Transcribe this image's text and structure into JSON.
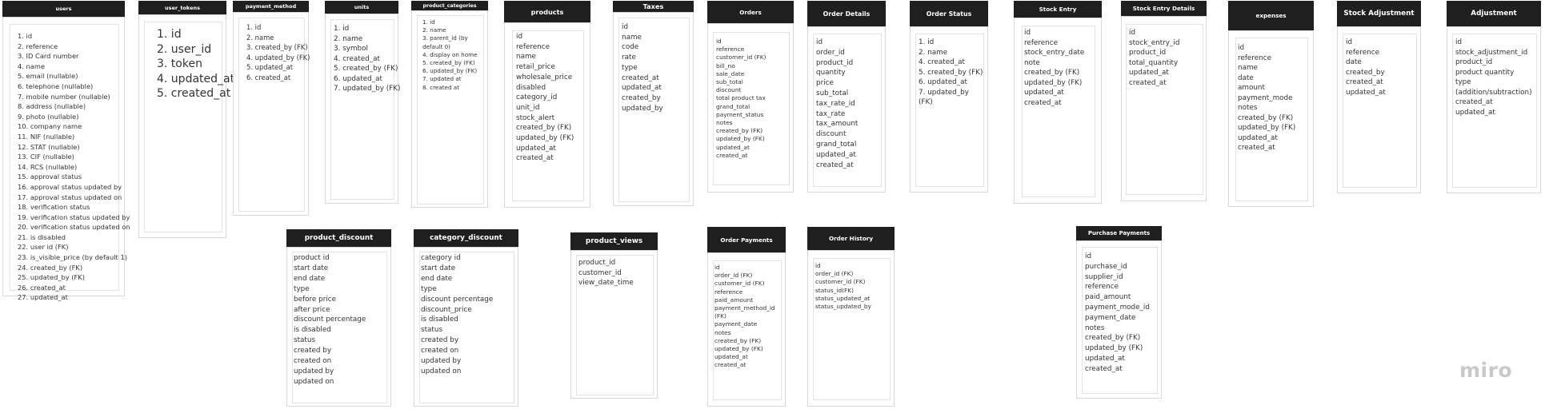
{
  "entities": [
    {
      "key": "users",
      "name": "users",
      "fields": [
        "1. id",
        "2. reference",
        "3. ID Card number",
        "4. name",
        "5. email (nullable)",
        "6. telephone (nullable)",
        "7. mobile number (nullable)",
        "8. address (nullable)",
        "9. photo (nullable)",
        "10. company name",
        "11. NIF (nullable)",
        "12. STAT (nullable)",
        "13. CIF (nullable)",
        "14. RCS (nullable)",
        "15. approval status",
        "16. approval status updated by",
        "17. approval status updated on",
        "18. verification status",
        "19. verification status updated by",
        "20. verification status updated on",
        "21. is disabled",
        "22. user id (FK)",
        "23. is_visible_price (by default 1)",
        "24. created_by (FK)",
        "25. updated_by (FK)",
        "26. created_at",
        "27. updated_at"
      ]
    },
    {
      "key": "user_tokens",
      "name": "user_tokens",
      "fields": [
        "1. id",
        "2. user_id",
        "3. token",
        "4. updated_at",
        "5. created_at"
      ]
    },
    {
      "key": "payment_method",
      "name": "payment_method",
      "fields": [
        "1. id",
        "2. name",
        "3. created_by (FK)",
        "4. updated_by (FK)",
        "5. updated_at",
        "6. created_at"
      ]
    },
    {
      "key": "units",
      "name": "units",
      "fields": [
        "1. id",
        "2. name",
        "3. symbol",
        "4. created_at",
        "5. created_by (FK)",
        "6. updated_at",
        "7. updated_by (FK)"
      ]
    },
    {
      "key": "product_categories",
      "name": "product_categories",
      "fields": [
        "1. id",
        "2. name",
        "3. parent_id (by",
        "default 0)",
        "4. display on home",
        "5. created_by (FK)",
        "6. updated_by (FK)",
        "7. updated at",
        "8. created at"
      ]
    },
    {
      "key": "products",
      "name": "products",
      "fields": [
        "id",
        "reference",
        "name",
        "retail_price",
        "wholesale_price",
        "disabled",
        "category_id",
        "unit_id",
        "stock_alert",
        "created_by (FK)",
        "updated_by (FK)",
        "updated_at",
        "created_at"
      ]
    },
    {
      "key": "taxes",
      "name": "Taxes",
      "fields": [
        "id",
        "name",
        "code",
        "rate",
        "type",
        "created_at",
        "updated_at",
        "created_by",
        "updated_by"
      ]
    },
    {
      "key": "orders",
      "name": "Orders",
      "fields": [
        "id",
        "reference",
        "customer_id (FK)",
        "bill_no",
        "sale_date",
        "sub_total",
        "discount",
        "total product tax",
        "grand_total",
        "payment_status",
        "notes",
        "created_by (FK)",
        "updated_by (FK)",
        "updated_at",
        "created_at"
      ]
    },
    {
      "key": "order_details",
      "name": "Order Details",
      "fields": [
        "id",
        "order_id",
        "product_id",
        "quantity",
        "price",
        "sub_total",
        "tax_rate_id",
        "tax_rate",
        "tax_amount",
        "discount",
        "grand_total",
        "updated_at",
        "created_at"
      ]
    },
    {
      "key": "order_status",
      "name": "Order Status",
      "fields": [
        "1. id",
        "2. name",
        "4. created_at",
        "5. created_by (FK)",
        "6. updated_at",
        "7. updated_by",
        "(FK)"
      ]
    },
    {
      "key": "stock_entry",
      "name": "Stock Entry",
      "fields": [
        "id",
        "reference",
        "stock_entry_date",
        "note",
        "created_by (FK)",
        "updated_by (FK)",
        "updated_at",
        "created_at"
      ]
    },
    {
      "key": "stock_entry_details",
      "name": "Stock Entry Details",
      "fields": [
        "id",
        "stock_entry_id",
        "product_id",
        "total_quantity",
        "updated_at",
        "created_at"
      ]
    },
    {
      "key": "expenses",
      "name": "expenses",
      "fields": [
        "id",
        "reference",
        "name",
        "date",
        "amount",
        "payment_mode",
        "notes",
        "created_by (FK)",
        "updated_by (FK)",
        "updated_at",
        "created_at"
      ]
    },
    {
      "key": "stock_adjustment",
      "name": "Stock Adjustment",
      "fields": [
        "id",
        "reference",
        "date",
        "created_by",
        "created_at",
        "updated_at"
      ]
    },
    {
      "key": "adjustment",
      "name": "Adjustment",
      "fields": [
        "id",
        "stock_adjustment_id",
        "product_id",
        "product quantity",
        "type",
        "(addition/subtraction)",
        "created_at",
        "updated_at"
      ]
    },
    {
      "key": "product_discount",
      "name": "product_discount",
      "fields": [
        "product id",
        "start date",
        "end date",
        "type",
        "before price",
        "after price",
        "discount percentage",
        "is disabled",
        "status",
        "created by",
        "created on",
        "updated by",
        "updated on"
      ]
    },
    {
      "key": "category_discount",
      "name": "category_discount",
      "fields": [
        "category id",
        "start date",
        "end date",
        "type",
        "discount percentage",
        "discount_price",
        "is disabled",
        "status",
        "created by",
        "created on",
        "updated by",
        "updated on"
      ]
    },
    {
      "key": "product_views",
      "name": "product_views",
      "fields": [
        "product_id",
        "customer_id",
        "view_date_time"
      ]
    },
    {
      "key": "order_payments",
      "name": "Order Payments",
      "fields": [
        "id",
        "order_id (FK)",
        "customer_id (FK)",
        "reference",
        "paid_amount",
        "payment_method_id",
        "(FK)",
        "payment_date",
        "notes",
        "created_by (FK)",
        "updated_by (FK)",
        "updated_at",
        "created_at"
      ]
    },
    {
      "key": "order_history",
      "name": "Order History",
      "fields": [
        "id",
        "order_id (FK)",
        "customer_id (FK)",
        "status_id(FK)",
        "status_updated_at",
        "status_updated_by"
      ]
    },
    {
      "key": "purchase_payments",
      "name": "Purchase Payments",
      "fields": [
        "id",
        "purchase_id",
        "supplier_id",
        "reference",
        "paid_amount",
        "payment_mode_id",
        "payment_date",
        "notes",
        "created_by (FK)",
        "updated_by (FK)",
        "updated_at",
        "created_at"
      ]
    }
  ],
  "watermark": "miro"
}
